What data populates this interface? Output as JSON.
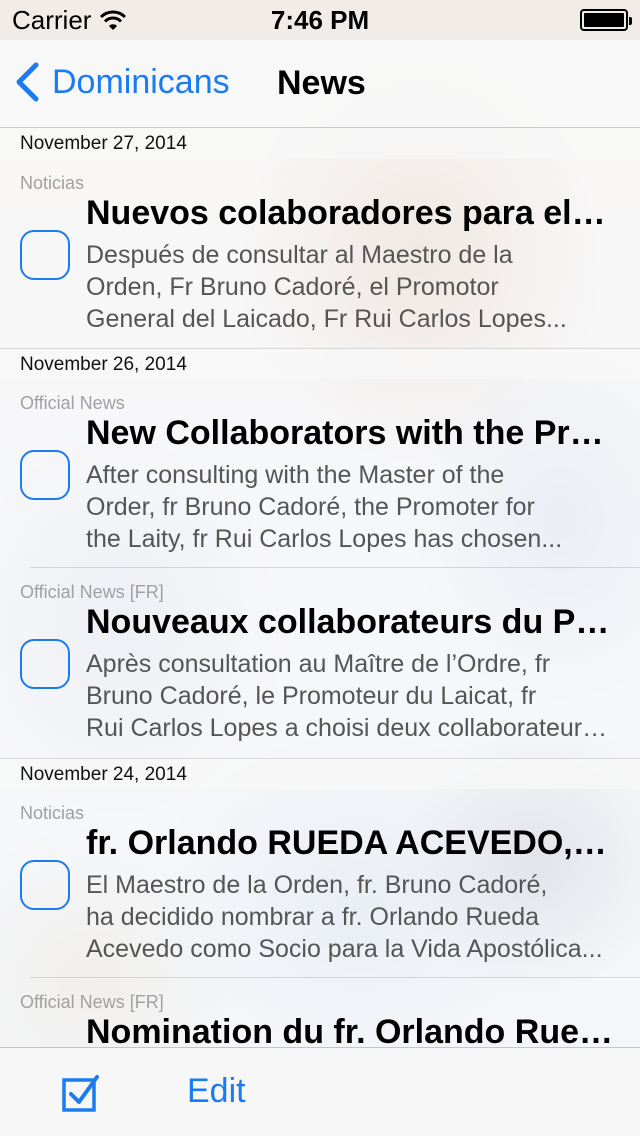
{
  "status_bar": {
    "carrier": "Carrier",
    "time": "7:46 PM"
  },
  "nav": {
    "back_label": "Dominicans",
    "title": "News"
  },
  "sections": [
    {
      "date": "November 27, 2014"
    },
    {
      "date": "November 26, 2014"
    },
    {
      "date": "November 24, 2014"
    }
  ],
  "items": [
    {
      "source": "Noticias",
      "title": "Nuevos colaboradores para el Laicado",
      "summary": [
        "Después de consultar al Maestro de la",
        "Orden, Fr Bruno Cadoré, el Promotor",
        "General del Laicado, Fr Rui Carlos Lopes..."
      ]
    },
    {
      "source": "Official News",
      "title": "New Collaborators with the Promoter",
      "summary": [
        "After consulting with the Master of the",
        "Order, fr Bruno Cadoré, the Promoter for",
        "the Laity, fr Rui Carlos Lopes has chosen..."
      ]
    },
    {
      "source": "Official News [FR]",
      "title": "Nouveaux collaborateurs du Promoteur",
      "summary": [
        "Après consultation au Maître de l’Ordre, fr",
        "Bruno Cadoré, le Promoteur du Laicat, fr",
        "Rui Carlos Lopes a choisi deux collaborateurs..."
      ]
    },
    {
      "source": "Noticias",
      "title": "fr. Orlando RUEDA ACEVEDO, Socio",
      "summary": [
        "El Maestro de la Orden, fr. Bruno Cadoré,",
        "ha decidido nombrar a fr. Orlando Rueda",
        "Acevedo como Socio para la Vida Apostólica..."
      ]
    },
    {
      "source": "Official News [FR]",
      "title": "Nomination du fr. Orlando Rueda",
      "summary": []
    }
  ],
  "toolbar": {
    "check_icon": "checkmark-square-icon",
    "edit_label": "Edit"
  },
  "colors": {
    "accent": "#1a7cf0"
  }
}
